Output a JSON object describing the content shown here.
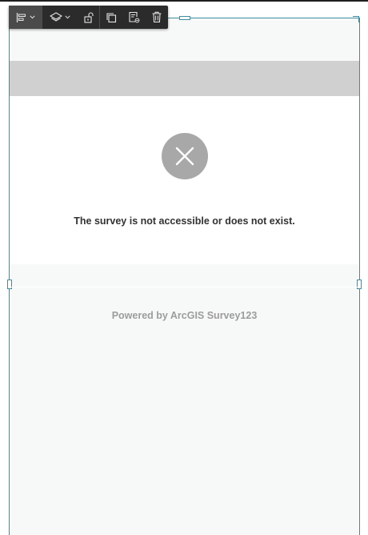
{
  "survey": {
    "error_message": "The survey is not accessible or does not exist.",
    "powered_by": "Powered by ArcGIS Survey123"
  },
  "toolbar": {
    "buttons": [
      "align",
      "layers",
      "unlock",
      "duplicate",
      "copy-settings",
      "delete"
    ]
  },
  "colors": {
    "selection": "#3f8b9f",
    "header_bar": "#d0d0d0",
    "error_icon": "#a8a8a8",
    "toolbar_bg": "#2b2b2b"
  }
}
